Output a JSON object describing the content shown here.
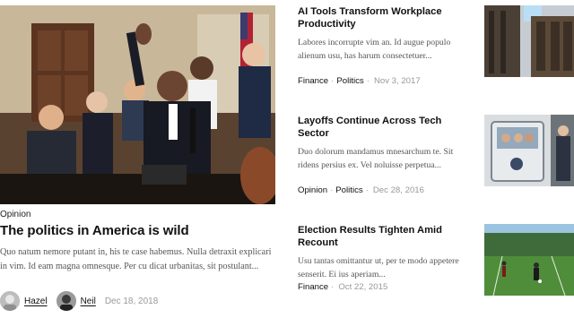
{
  "featured": {
    "category": "Opinion",
    "title": "The politics in America is wild",
    "excerpt": "Quo natum nemore putant in, his te case habemus. Nulla detraxit explicari in vim. Id eam magna omnesque. Per cu dicat urbanitas, sit postulant...",
    "authors": [
      {
        "name": "Hazel"
      },
      {
        "name": "Neil"
      }
    ],
    "date": "Dec 18, 2018"
  },
  "articles": [
    {
      "title": "AI Tools Transform Workplace Productivity",
      "excerpt": "Labores incorrupte vim an. Id augue populo alienum usu, has harum consectetuer...",
      "tags": [
        "Finance",
        "Politics"
      ],
      "date": "Nov 3, 2017"
    },
    {
      "title": "Layoffs Continue Across Tech Sector",
      "excerpt": "Duo dolorum mandamus mnesarchum te. Sit ridens persius ex. Vel noluisse perpetua...",
      "tags": [
        "Opinion",
        "Politics"
      ],
      "date": "Dec 28, 2016"
    },
    {
      "title": "Election Results Tighten Amid Recount",
      "excerpt": "Usu tantas omittantur ut, per te modo appetere senserit. Ei ius aperiam...",
      "tags": [
        "Finance"
      ],
      "date": "Oct 22, 2015"
    }
  ]
}
